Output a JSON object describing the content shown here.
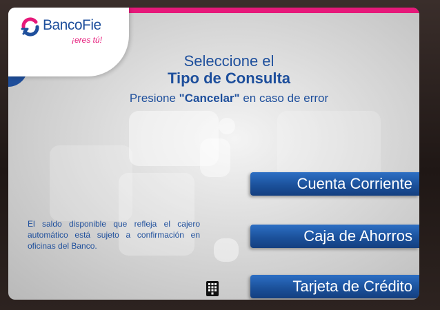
{
  "brand": {
    "name_part1": "Banco",
    "name_part2": "Fie",
    "tagline": "¡eres tú!"
  },
  "heading": {
    "line1": "Seleccione el",
    "line2": "Tipo de Consulta",
    "line3_pre": "Presione ",
    "line3_strong": "\"Cancelar\"",
    "line3_post": " en caso de error"
  },
  "menu": {
    "options": [
      {
        "label": "Cuenta Corriente"
      },
      {
        "label": "Caja de Ahorros"
      },
      {
        "label": "Tarjeta de Crédito"
      }
    ]
  },
  "notice": "El saldo disponible que refleja el cajero automático está sujeto a confirmación en oficinas del Banco.",
  "icons": {
    "keypad": "keypad-icon",
    "logo": "bancofie-logo-icon"
  },
  "colors": {
    "brand_blue": "#1e4f9c",
    "brand_pink": "#e6197a",
    "button_blue": "#1a4f98"
  }
}
